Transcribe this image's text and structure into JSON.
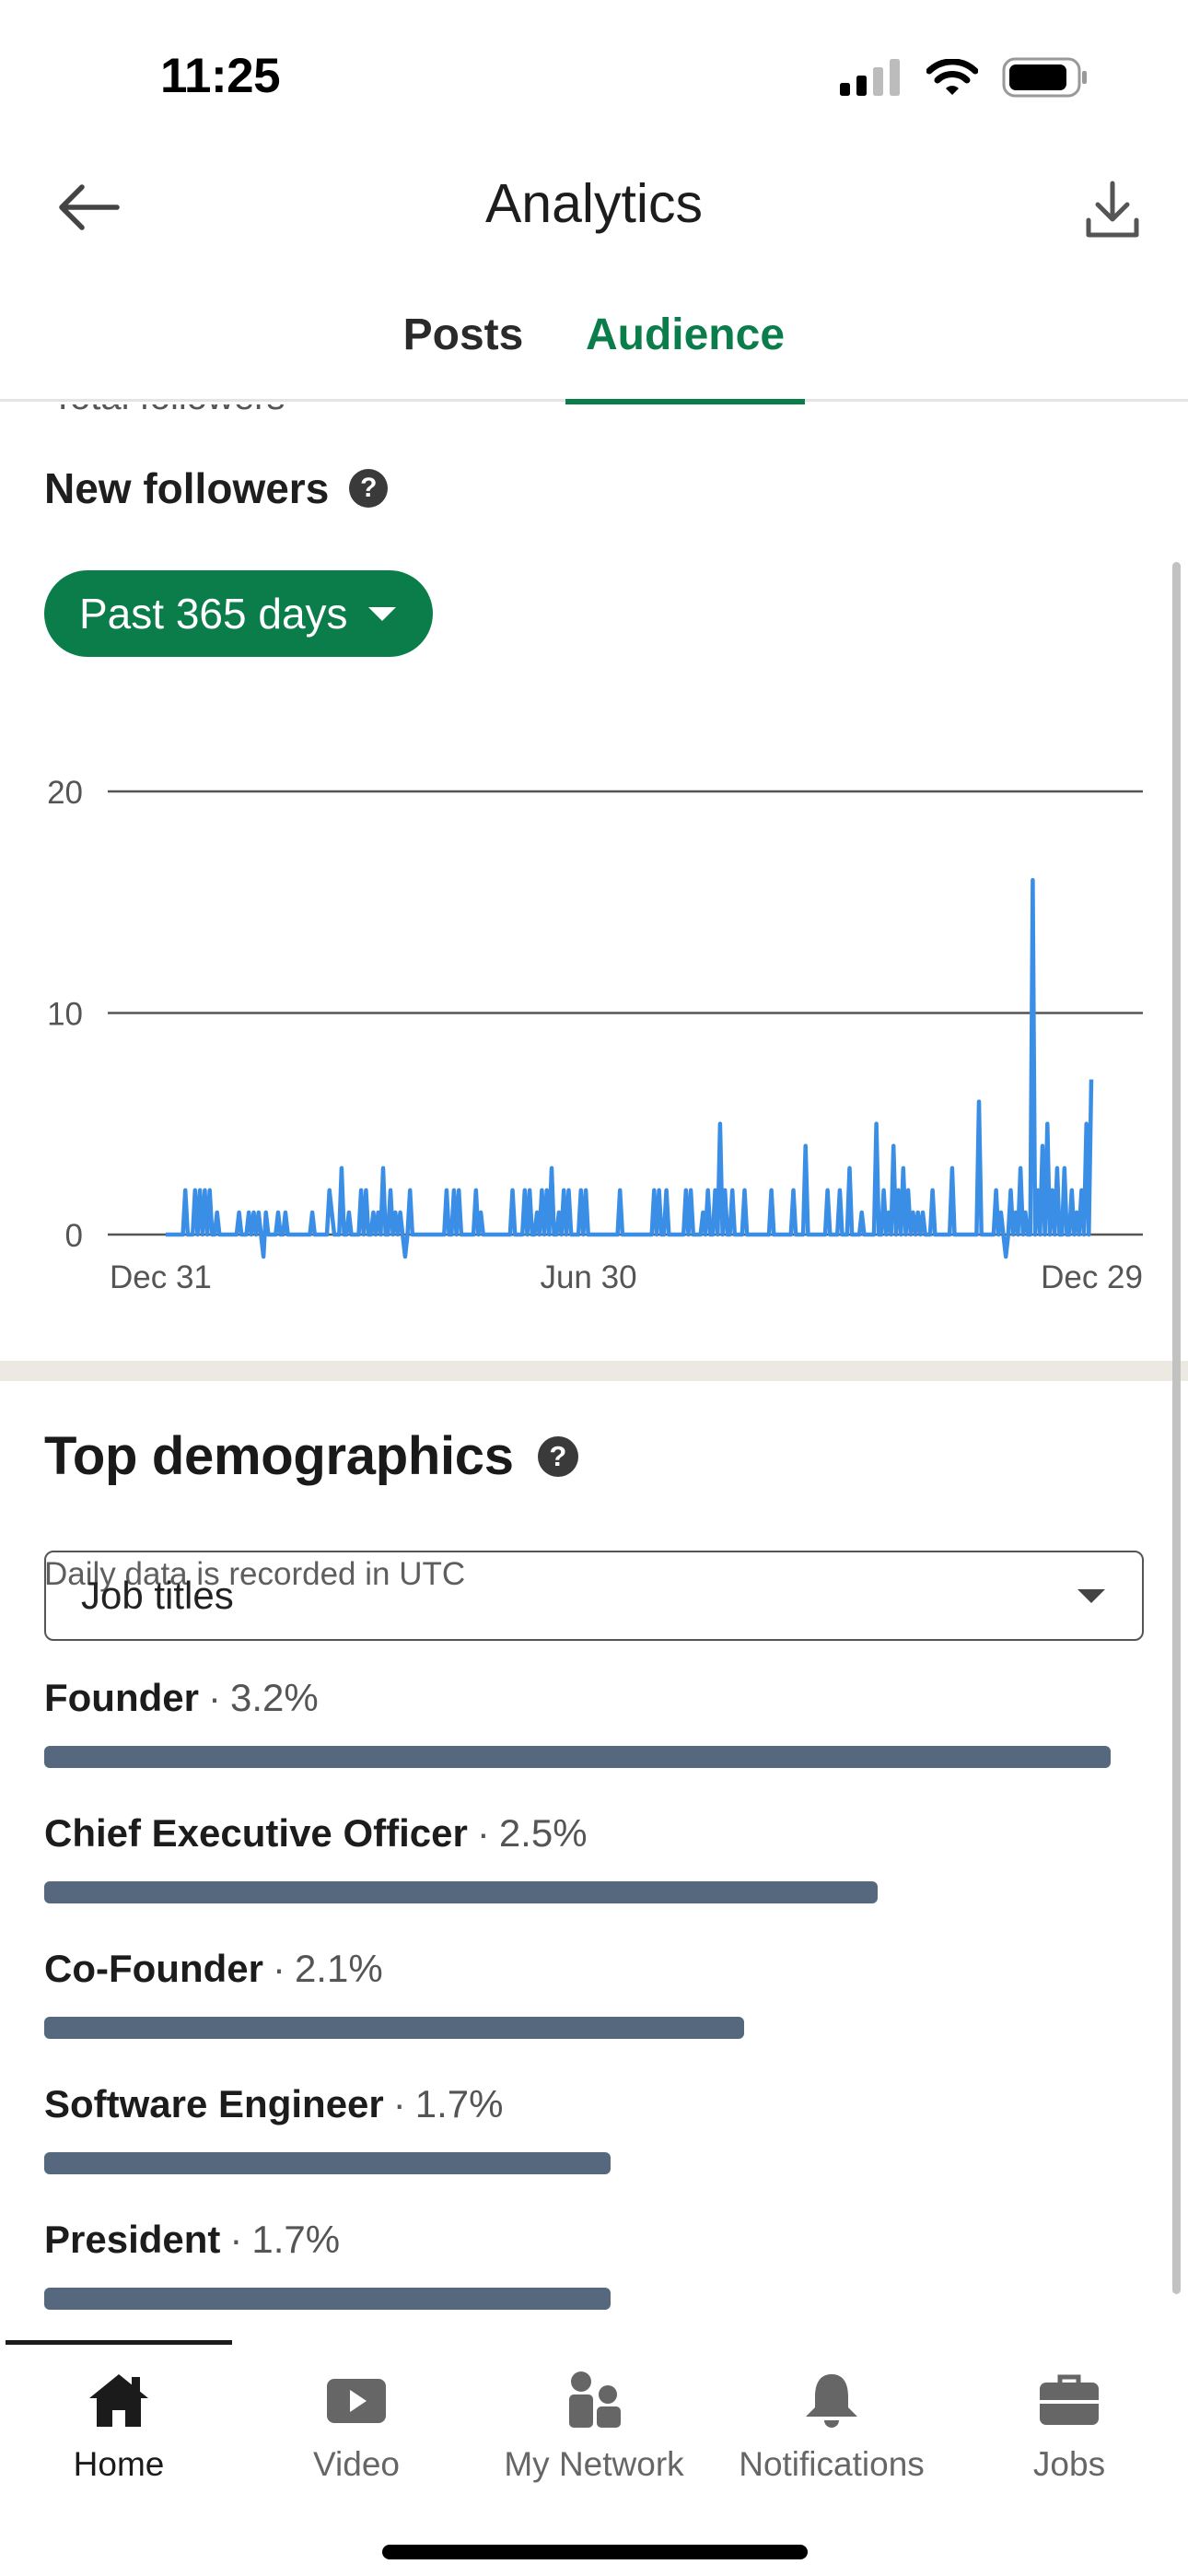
{
  "status_bar": {
    "time": "11:25",
    "icons": [
      "cellular-signal-icon",
      "wifi-icon",
      "battery-icon"
    ]
  },
  "header": {
    "title": "Analytics",
    "back_icon": "back-arrow-icon",
    "download_icon": "download-icon"
  },
  "tabs": [
    {
      "label": "Posts",
      "active": false
    },
    {
      "label": "Audience",
      "active": true
    }
  ],
  "colors": {
    "accent": "#0a7d4b",
    "line": "#3a8ee6",
    "bar": "#56687d",
    "section_divider": "#ece9e3"
  },
  "followers": {
    "partial_label": "Total followers",
    "heading": "New followers",
    "help_icon": "help-icon",
    "range_label": "Past 365 days",
    "note": "Daily data is recorded in UTC"
  },
  "chart_data": {
    "type": "line",
    "title": "",
    "xlabel": "",
    "ylabel": "",
    "ylim": [
      0,
      20
    ],
    "yticks": [
      0,
      10,
      20
    ],
    "xtick_labels": [
      "Dec 31",
      "Jun 30",
      "Dec 29"
    ],
    "grid": true,
    "legend": "none",
    "series": [
      {
        "name": "",
        "values": [
          0,
          0,
          0,
          0,
          0,
          0,
          0,
          0,
          2,
          0,
          0,
          0,
          2,
          0,
          2,
          0,
          2,
          0,
          2,
          0,
          0,
          1,
          0,
          0,
          0,
          0,
          0,
          0,
          0,
          0,
          1,
          0,
          0,
          0,
          1,
          0,
          1,
          0,
          1,
          0,
          -1,
          1,
          0,
          0,
          0,
          0,
          1,
          0,
          0,
          1,
          0,
          0,
          0,
          0,
          0,
          0,
          0,
          0,
          0,
          0,
          1,
          0,
          0,
          0,
          0,
          0,
          0,
          2,
          1,
          0,
          0,
          0,
          3,
          0,
          0,
          1,
          0,
          0,
          0,
          0,
          2,
          0,
          2,
          0,
          0,
          1,
          0,
          1,
          0,
          3,
          0,
          0,
          2,
          0,
          1,
          0,
          1,
          0,
          -1,
          0,
          2,
          0,
          0,
          0,
          0,
          0,
          0,
          0,
          0,
          0,
          0,
          0,
          0,
          0,
          0,
          2,
          0,
          0,
          2,
          0,
          2,
          0,
          0,
          0,
          0,
          0,
          0,
          2,
          0,
          1,
          0,
          0,
          0,
          0,
          0,
          0,
          0,
          0,
          0,
          0,
          0,
          0,
          2,
          0,
          0,
          0,
          0,
          2,
          0,
          2,
          0,
          0,
          1,
          0,
          2,
          0,
          2,
          0,
          3,
          0,
          0,
          1,
          0,
          2,
          0,
          2,
          0,
          0,
          0,
          0,
          2,
          0,
          2,
          0,
          0,
          0,
          0,
          0,
          0,
          0,
          0,
          0,
          0,
          0,
          0,
          0,
          2,
          0,
          0,
          0,
          0,
          0,
          0,
          0,
          0,
          0,
          0,
          0,
          0,
          0,
          2,
          0,
          2,
          0,
          0,
          2,
          0,
          0,
          0,
          0,
          0,
          0,
          0,
          2,
          0,
          2,
          0,
          0,
          0,
          0,
          1,
          0,
          2,
          0,
          0,
          2,
          0,
          5,
          0,
          2,
          0,
          0,
          2,
          0,
          0,
          0,
          0,
          2,
          0,
          0,
          0,
          0,
          0,
          0,
          0,
          0,
          0,
          0,
          2,
          0,
          0,
          0,
          0,
          0,
          0,
          0,
          0,
          2,
          0,
          0,
          0,
          0,
          4,
          0,
          0,
          0,
          0,
          0,
          0,
          0,
          0,
          2,
          0,
          0,
          0,
          0,
          2,
          0,
          0,
          0,
          3,
          0,
          0,
          0,
          0,
          1,
          0,
          0,
          0,
          0,
          0,
          5,
          0,
          0,
          2,
          0,
          1,
          0,
          4,
          0,
          2,
          0,
          3,
          0,
          2,
          0,
          1,
          0,
          1,
          0,
          1,
          0,
          0,
          0,
          2,
          0,
          0,
          0,
          0,
          0,
          0,
          0,
          3,
          0,
          0,
          0,
          0,
          0,
          0,
          0,
          0,
          0,
          0,
          6,
          0,
          0,
          0,
          0,
          0,
          0,
          2,
          0,
          1,
          0,
          -1,
          0,
          2,
          0,
          1,
          0,
          3,
          0,
          1,
          0,
          0,
          16,
          0,
          2,
          0,
          4,
          0,
          5,
          0,
          2,
          0,
          3,
          0,
          0,
          3,
          0,
          0,
          2,
          0,
          1,
          0,
          2,
          0,
          5,
          0,
          7
        ]
      }
    ]
  },
  "demographics": {
    "title": "Top demographics",
    "help_icon": "help-icon",
    "filter": {
      "selected": "Job titles"
    },
    "items": [
      {
        "label": "Founder",
        "separator": "·",
        "percent_text": "3.2%",
        "value": 3.2
      },
      {
        "label": "Chief Executive Officer",
        "separator": "·",
        "percent_text": "2.5%",
        "value": 2.5
      },
      {
        "label": "Co-Founder",
        "separator": "·",
        "percent_text": "2.1%",
        "value": 2.1
      },
      {
        "label": "Software Engineer",
        "separator": "·",
        "percent_text": "1.7%",
        "value": 1.7
      },
      {
        "label": "President",
        "separator": "·",
        "percent_text": "1.7%",
        "value": 1.7
      }
    ]
  },
  "bottom_nav": [
    {
      "label": "Home",
      "icon": "home-icon",
      "active": true
    },
    {
      "label": "Video",
      "icon": "video-icon",
      "active": false
    },
    {
      "label": "My Network",
      "icon": "my-network-icon",
      "active": false
    },
    {
      "label": "Notifications",
      "icon": "bell-icon",
      "active": false
    },
    {
      "label": "Jobs",
      "icon": "briefcase-icon",
      "active": false
    }
  ]
}
